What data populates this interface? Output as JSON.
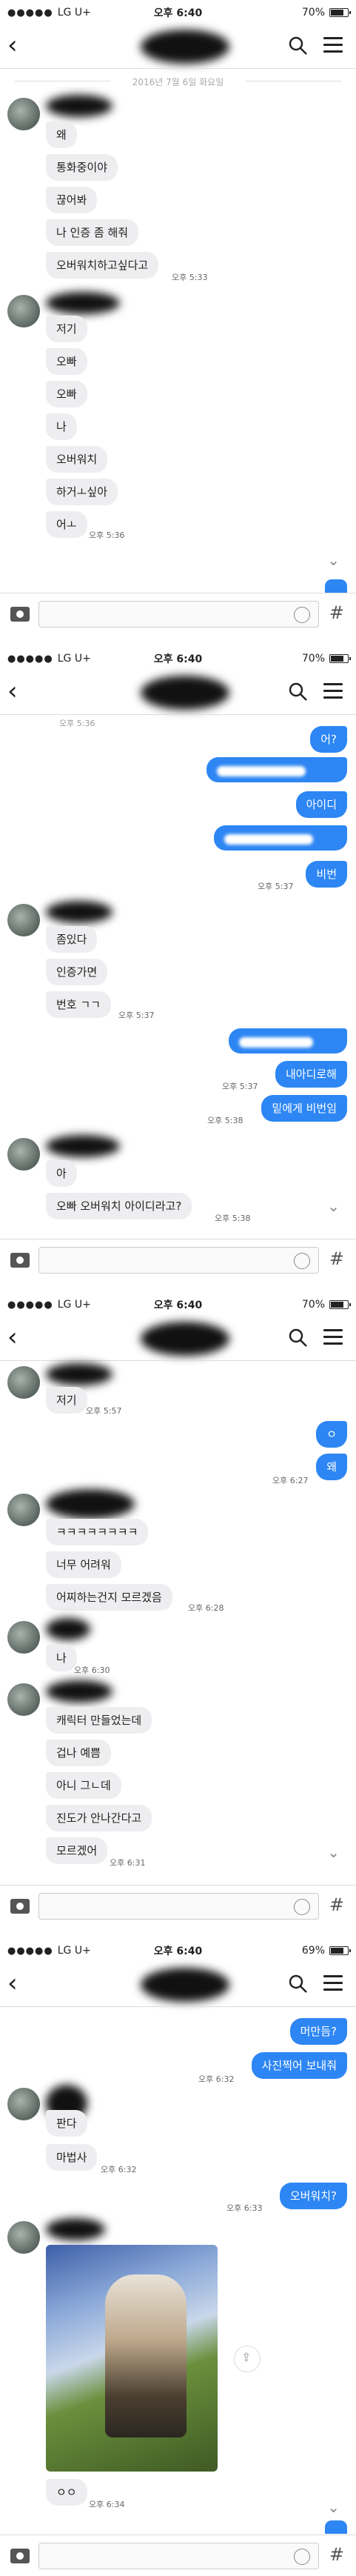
{
  "status": {
    "carrier": "LG U+",
    "signal": "●●●●●",
    "time": "오후 6:40"
  },
  "screens": [
    {
      "battery": "70%",
      "date_divider": "2016년 7월 6일 화요일",
      "messages": [
        {
          "dir": "in",
          "text": "왜"
        },
        {
          "dir": "in",
          "text": "통화중이야"
        },
        {
          "dir": "in",
          "text": "끊어봐"
        },
        {
          "dir": "in",
          "text": "나 인증 좀 해줘"
        },
        {
          "dir": "in",
          "text": "오버워치하고싶다고",
          "time": "오후 5:33"
        },
        {
          "dir": "in",
          "text": "저기"
        },
        {
          "dir": "in",
          "text": "오빠"
        },
        {
          "dir": "in",
          "text": "오빠"
        },
        {
          "dir": "in",
          "text": "나"
        },
        {
          "dir": "in",
          "text": "오버워치"
        },
        {
          "dir": "in",
          "text": "하거ㅗ싶아"
        },
        {
          "dir": "in",
          "text": "어ㅗ",
          "time": "오후 5:36"
        }
      ]
    },
    {
      "battery": "70%",
      "top_time": "오후 5:36",
      "messages": [
        {
          "dir": "out",
          "text": "어?"
        },
        {
          "dir": "out",
          "text": ""
        },
        {
          "dir": "out",
          "text": "아이디"
        },
        {
          "dir": "out",
          "text": ""
        },
        {
          "dir": "out",
          "text": "비번",
          "time": "오후 5:37"
        },
        {
          "dir": "in",
          "text": "좀있다"
        },
        {
          "dir": "in",
          "text": "인증가면"
        },
        {
          "dir": "in",
          "text": "번호 ㄱㄱ",
          "time": "오후 5:37"
        },
        {
          "dir": "out",
          "text": ""
        },
        {
          "dir": "out",
          "text": "내아디로해",
          "time": "오후 5:37"
        },
        {
          "dir": "out",
          "text": "밑에게 비번임",
          "time": "오후 5:38"
        },
        {
          "dir": "in",
          "text": "아"
        },
        {
          "dir": "in",
          "text": "오빠 오버워치 아이디라고?",
          "time": "오후 5:38"
        }
      ]
    },
    {
      "battery": "70%",
      "messages": [
        {
          "dir": "in",
          "text": "저기",
          "time": "오후 5:57"
        },
        {
          "dir": "out",
          "text": "ㅇ"
        },
        {
          "dir": "out",
          "text": "왜",
          "time": "오후 6:27"
        },
        {
          "dir": "in",
          "text": "ㅋㅋㅋㅋㅋㅋㅋㅋ"
        },
        {
          "dir": "in",
          "text": "너무 어려워"
        },
        {
          "dir": "in",
          "text": "어찌하는건지 모르겠음",
          "time": "오후 6:28"
        },
        {
          "dir": "in",
          "text": "나",
          "time": "오후 6:30"
        },
        {
          "dir": "in",
          "text": "캐릭터 만들었는데"
        },
        {
          "dir": "in",
          "text": "겁나 예쁨"
        },
        {
          "dir": "in",
          "text": "아니 그ㄴ데"
        },
        {
          "dir": "in",
          "text": "진도가 안나간다고"
        },
        {
          "dir": "in",
          "text": "모르겠어",
          "time": "오후 6:31"
        }
      ]
    },
    {
      "battery": "69%",
      "messages": [
        {
          "dir": "out",
          "text": "머만듬?"
        },
        {
          "dir": "out",
          "text": "사진찍어 보내줘",
          "time": "오후 6:32"
        },
        {
          "dir": "in",
          "text": "판다"
        },
        {
          "dir": "in",
          "text": "마법사",
          "time": "오후 6:32"
        },
        {
          "dir": "out",
          "text": "오버워치?",
          "time": "오후 6:33"
        },
        {
          "dir": "in",
          "text": "ㅇㅇ",
          "time": "오후 6:34"
        }
      ]
    }
  ],
  "icons": [
    "back-icon",
    "search-icon",
    "menu-icon",
    "camera-icon",
    "emoji-icon",
    "hash-icon",
    "chevron-down-icon",
    "share-icon"
  ],
  "colors": {
    "outgoing": "#2d86f3",
    "incoming": "#eeeef0"
  }
}
